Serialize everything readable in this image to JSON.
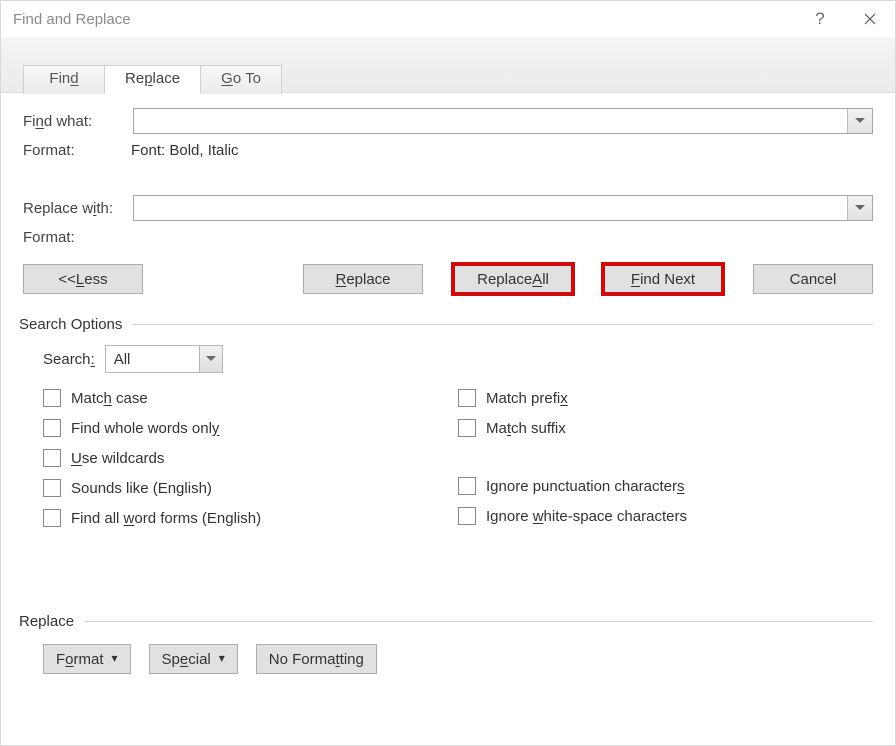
{
  "title": "Find and Replace",
  "tabs": {
    "find": "Find",
    "replace": "Replace",
    "goto": "Go To"
  },
  "labels": {
    "findwhat": "Find what:",
    "format1": "Format:",
    "formatval": "Font: Bold, Italic",
    "replacewith": "Replace with:",
    "format2": "Format:"
  },
  "buttons": {
    "less": "<< Less",
    "replace": "Replace",
    "replaceAll": "Replace All",
    "findNext": "Find Next",
    "cancel": "Cancel",
    "format": "Format",
    "special": "Special",
    "noFormatting": "No Formatting"
  },
  "search": {
    "header": "Search Options",
    "searchLabel": "Search:",
    "direction": "All",
    "options": {
      "matchCase": "Match case",
      "wholeWords": "Find whole words only",
      "wildcards": "Use wildcards",
      "soundsLike": "Sounds like (English)",
      "wordForms": "Find all word forms (English)",
      "matchPrefix": "Match prefix",
      "matchSuffix": "Match suffix",
      "ignorePunct": "Ignore punctuation characters",
      "ignoreWS": "Ignore white-space characters"
    }
  },
  "replaceHeader": "Replace"
}
